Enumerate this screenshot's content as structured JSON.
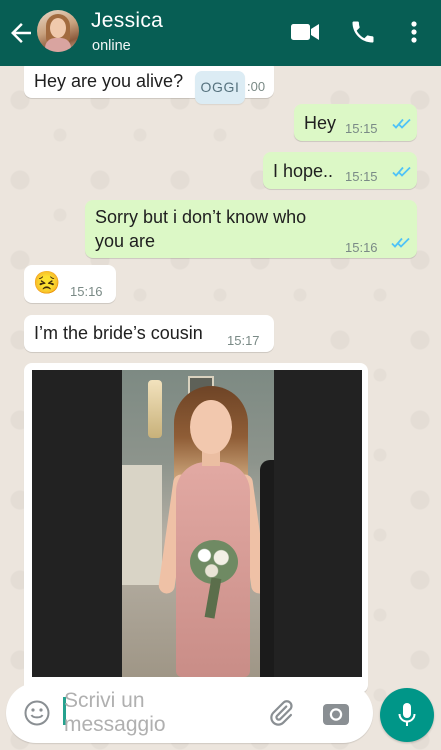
{
  "header": {
    "contact_name": "Jessica",
    "status": "online",
    "icons": [
      "back-arrow-icon",
      "video-call-icon",
      "voice-call-icon",
      "more-options-icon"
    ]
  },
  "date_chip": "OGGI",
  "messages": [
    {
      "direction": "incoming",
      "text": "Hey are you alive?",
      "time": ":00"
    },
    {
      "direction": "outgoing",
      "text": "Hey",
      "time": "15:15",
      "status": "read"
    },
    {
      "direction": "outgoing",
      "text": "I hope..",
      "time": "15:15",
      "status": "read"
    },
    {
      "direction": "outgoing",
      "text": "Sorry but i don’t know who you are",
      "time": "15:16",
      "status": "read"
    },
    {
      "direction": "incoming",
      "text": "😣",
      "time": "15:16"
    },
    {
      "direction": "incoming",
      "text": "I’m the bride’s cousin",
      "time": "15:17"
    },
    {
      "direction": "incoming",
      "type": "image",
      "image_description": "photo"
    }
  ],
  "input": {
    "placeholder": "Scrivi un messaggio",
    "icons": [
      "emoji-icon",
      "attach-icon",
      "camera-icon",
      "mic-icon"
    ]
  },
  "colors": {
    "header": "#075e54",
    "outgoing_bubble": "#dcf8c6",
    "incoming_bubble": "#ffffff",
    "read_ticks": "#4fc3f7",
    "mic_button": "#009688"
  }
}
